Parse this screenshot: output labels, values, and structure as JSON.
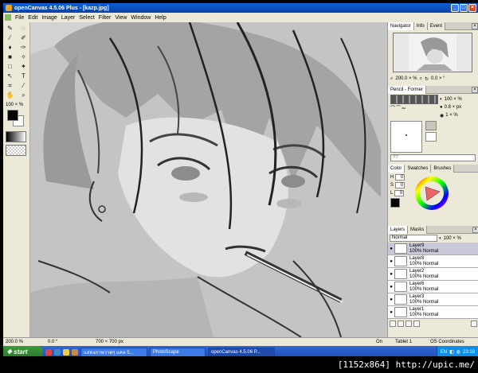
{
  "window": {
    "title": "openCanvas 4.5.06 Plus - [kazp.jpg]",
    "controls": [
      "_",
      "□",
      "×"
    ]
  },
  "menu": [
    "File",
    "Edit",
    "Image",
    "Layer",
    "Select",
    "Filter",
    "View",
    "Window",
    "Help"
  ],
  "toolbox": {
    "zoom": "100 × %"
  },
  "navigator": {
    "tabs": [
      "Navigator",
      "Info",
      "Event"
    ],
    "zoom": "200.0 × %",
    "angle": "0.0 × °"
  },
  "pencil": {
    "tab": "Pencil - Former",
    "opacity": "100 × %",
    "size": "0.8 × px",
    "density": "1 × %"
  },
  "color": {
    "tabs": [
      "Color",
      "Swatches",
      "Brushes"
    ],
    "h_label": "H",
    "h_value": "0",
    "s_label": "S",
    "s_value": "0",
    "l_label": "L",
    "l_value": "0"
  },
  "layers": {
    "tabs": [
      "Layers",
      "Masks"
    ],
    "mode": "Normal",
    "opacity": "100 × %",
    "items": [
      {
        "name": "Layer9",
        "mode": "100% Normal"
      },
      {
        "name": "Layer8",
        "mode": "100% Normal"
      },
      {
        "name": "Layer2",
        "mode": "100% Normal"
      },
      {
        "name": "Layer6",
        "mode": "100% Normal"
      },
      {
        "name": "Layer3",
        "mode": "100% Normal"
      },
      {
        "name": "Layer1",
        "mode": "100% Normal"
      }
    ]
  },
  "status": {
    "zoom": "200.0 %",
    "angle": "0.0 °",
    "size": "700 × 700 px",
    "state": "On",
    "tablet": "Tablet 1",
    "coords": "OS Coordinates"
  },
  "taskbar": {
    "start": "start",
    "tasks": [
      "แสดงภาพวาดๆ แคล 5...",
      "PhotoScape",
      "openCanvas 4.5.06 P..."
    ],
    "lang": "EN",
    "time": "23:18"
  },
  "banner": "[1152x864] http://upic.me/"
}
